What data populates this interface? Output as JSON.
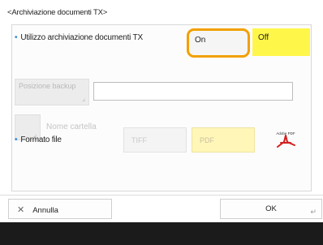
{
  "screen": {
    "title": "<Archiviazione documenti TX>"
  },
  "archive_setting": {
    "label": "Utilizzo archiviazione documenti TX",
    "on_label": "On",
    "off_label": "Off",
    "selected": "Off"
  },
  "backup_position": {
    "button_label": "Posizione backup",
    "input_value": ""
  },
  "folder": {
    "label": "Nome cartella"
  },
  "file_format": {
    "label": "Formato file",
    "options": [
      "TIFF",
      "PDF"
    ],
    "selected": "PDF",
    "pdf_icon_text": "Adobe PDF"
  },
  "footer": {
    "cancel_label": "Annulla",
    "ok_label": "OK"
  },
  "colors": {
    "selected_yellow": "#fff64a",
    "focus_orange": "#f2a000",
    "bullet_blue": "#3a8fd8"
  }
}
